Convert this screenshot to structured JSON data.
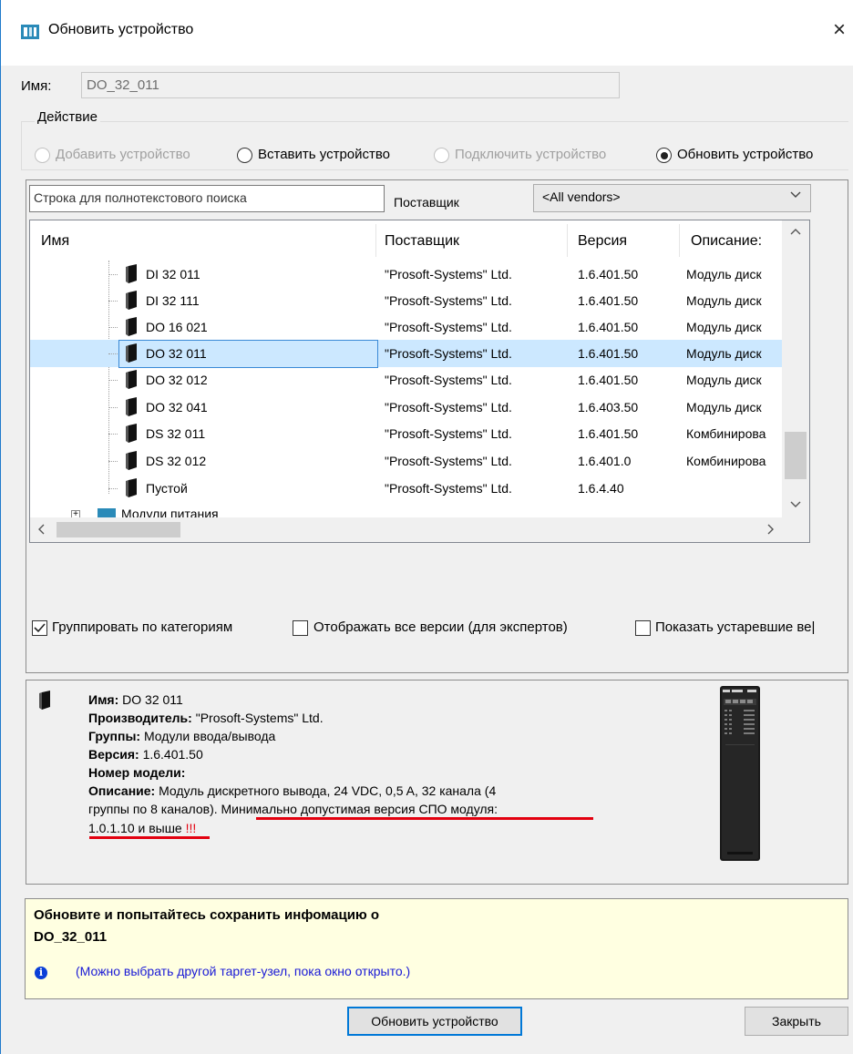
{
  "window": {
    "title": "Обновить устройство",
    "close_glyph": "×"
  },
  "name_row": {
    "label": "Имя:",
    "value": "DO_32_011"
  },
  "action_group": {
    "label": "Действие",
    "options": [
      {
        "label": "Добавить устройство",
        "enabled": false,
        "checked": false
      },
      {
        "label": "Вставить устройство",
        "enabled": true,
        "checked": false
      },
      {
        "label": "Подключить устройство",
        "enabled": false,
        "checked": false
      },
      {
        "label": "Обновить устройство",
        "enabled": true,
        "checked": true
      }
    ]
  },
  "search": {
    "placeholder": "Строка для полнотекстового поиска",
    "vendor_label": "Поставщик",
    "vendor_value": "<All vendors>"
  },
  "table": {
    "columns": [
      "Имя",
      "Поставщик",
      "Версия",
      "Описание:"
    ],
    "rows": [
      {
        "name": "DI 32 011",
        "vendor": "\"Prosoft-Systems\" Ltd.",
        "version": "1.6.401.50",
        "description": "Модуль диск",
        "selected": false
      },
      {
        "name": "DI 32 111",
        "vendor": "\"Prosoft-Systems\" Ltd.",
        "version": "1.6.401.50",
        "description": "Модуль диск",
        "selected": false
      },
      {
        "name": "DO 16 021",
        "vendor": "\"Prosoft-Systems\" Ltd.",
        "version": "1.6.401.50",
        "description": "Модуль диск",
        "selected": false
      },
      {
        "name": "DO 32 011",
        "vendor": "\"Prosoft-Systems\" Ltd.",
        "version": "1.6.401.50",
        "description": "Модуль диск",
        "selected": true
      },
      {
        "name": "DO 32 012",
        "vendor": "\"Prosoft-Systems\" Ltd.",
        "version": "1.6.401.50",
        "description": "Модуль диск",
        "selected": false
      },
      {
        "name": "DO 32 041",
        "vendor": "\"Prosoft-Systems\" Ltd.",
        "version": "1.6.403.50",
        "description": "Модуль диск",
        "selected": false
      },
      {
        "name": "DS 32 011",
        "vendor": "\"Prosoft-Systems\" Ltd.",
        "version": "1.6.401.50",
        "description": "Комбинирова",
        "selected": false
      },
      {
        "name": "DS 32 012",
        "vendor": "\"Prosoft-Systems\" Ltd.",
        "version": "1.6.401.0",
        "description": "Комбинирова",
        "selected": false
      },
      {
        "name": "Пустой",
        "vendor": "\"Prosoft-Systems\" Ltd.",
        "version": "1.6.4.40",
        "description": "",
        "selected": false
      }
    ],
    "partial_group_label": "Модули питания"
  },
  "options": {
    "group_by_category": {
      "label": "Группировать по категориям",
      "checked": true
    },
    "show_all_versions": {
      "label": "Отображать все версии (для экспертов)",
      "checked": false
    },
    "show_obsolete": {
      "label": "Показать устаревшие ве|",
      "checked": false
    }
  },
  "details": {
    "name_label": "Имя:",
    "name_value": "DO 32 011",
    "manufacturer_label": "Производитель:",
    "manufacturer_value": "\"Prosoft-Systems\" Ltd.",
    "groups_label": "Группы:",
    "groups_value": "Модули ввода/вывода",
    "version_label": "Версия:",
    "version_value": "1.6.401.50",
    "model_label": "Номер модели:",
    "description_label": "Описание:",
    "description_line1": "Модуль дискретного вывода, 24 VDC, 0,5 A, 32 канала (4",
    "description_line2_plain": "группы по 8 каналов). ",
    "description_line2_highlight": "Минимально допустимая версия СПО модуля:",
    "description_line3": "1.0.1.10 и выше",
    "annotation_mark": "!!!",
    "annotation_color": "#e3000f"
  },
  "message": {
    "line1": "Обновите и попытайтесь сохранить инфомацию о",
    "line2": "DO_32_011",
    "hint": "(Можно выбрать другой таргет-узел, пока окно открыто.)",
    "info_icon_glyph": "i"
  },
  "buttons": {
    "update": "Обновить устройство",
    "close": "Закрыть"
  },
  "colors": {
    "accent": "#0078d7",
    "selection": "#cce8ff",
    "message_bg": "#ffffe1",
    "hint_text": "#1a1ad6"
  }
}
